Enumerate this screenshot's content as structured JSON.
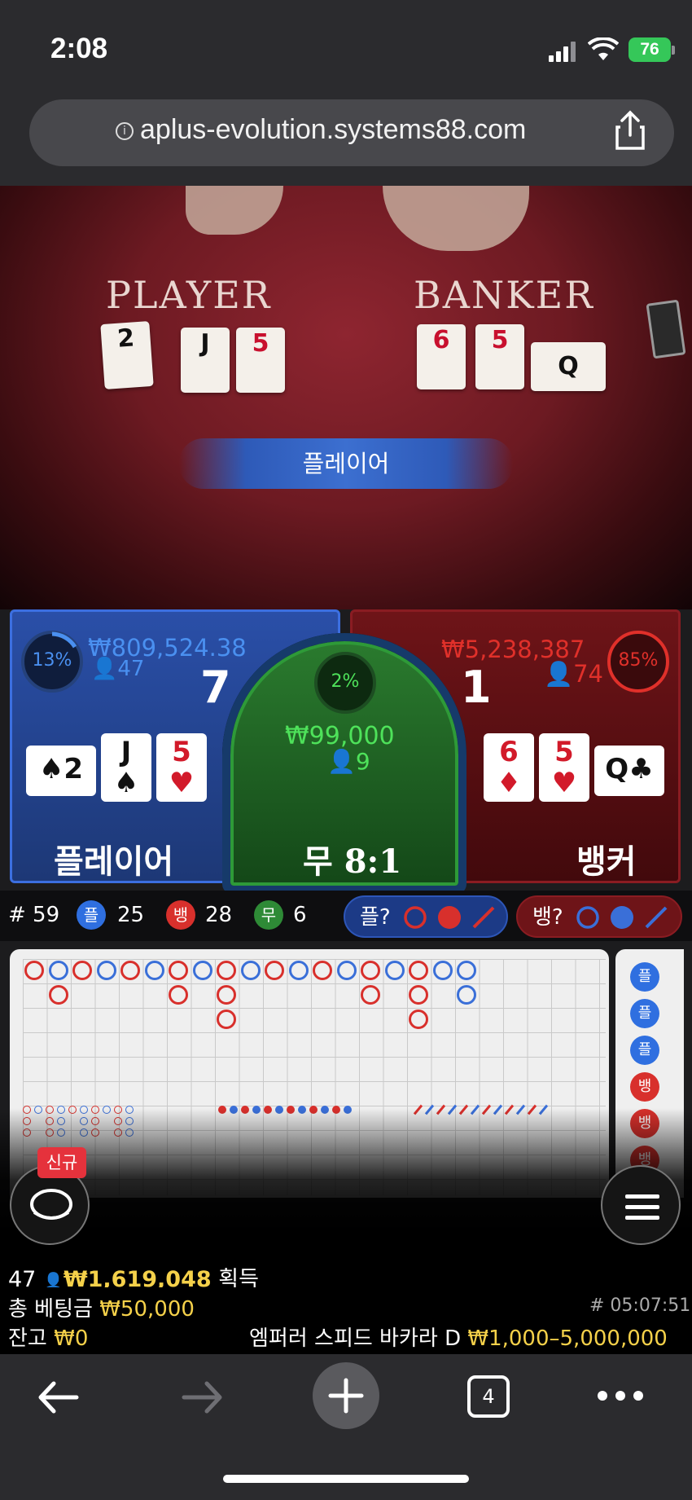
{
  "status_bar": {
    "time": "2:08",
    "battery": "76"
  },
  "browser": {
    "url": "aplus-evolution.systems88.com",
    "tab_count": "4"
  },
  "video": {
    "player_label": "PLAYER",
    "banker_label": "BANKER",
    "player_cards": [
      "2",
      "J",
      "5"
    ],
    "banker_cards": [
      "6",
      "5",
      "Q"
    ],
    "result": "플레이어"
  },
  "bets": {
    "player": {
      "percent": "13%",
      "amount": "₩809,524.38",
      "players": "47",
      "score": "7",
      "title": "플레이어",
      "cards": [
        {
          "rank": "2",
          "suit": "♠"
        },
        {
          "rank": "J",
          "suit": "♠"
        },
        {
          "rank": "5",
          "suit": "♥"
        }
      ]
    },
    "tie": {
      "percent": "2%",
      "amount": "₩99,000",
      "players": "9",
      "title": "무 8:1"
    },
    "banker": {
      "percent": "85%",
      "amount": "₩5,238,387",
      "players": "74",
      "score": "1",
      "title": "뱅커",
      "cards": [
        {
          "rank": "6",
          "suit": "♦"
        },
        {
          "rank": "5",
          "suit": "♥"
        },
        {
          "rank": "Q",
          "suit": "♣"
        }
      ]
    }
  },
  "stats": {
    "round": "# 59",
    "player_label": "플",
    "player_count": "25",
    "banker_label": "뱅",
    "banker_count": "28",
    "tie_label": "무",
    "tie_count": "6",
    "player_predict": "플?",
    "banker_predict": "뱅?"
  },
  "roadmap": {
    "top_row": [
      "r",
      "b",
      "r",
      "b",
      "r",
      "b",
      "r",
      "b",
      "r",
      "b",
      "r",
      "b",
      "r",
      "b",
      "r",
      "b",
      "r",
      "b",
      "b"
    ],
    "side": [
      "플",
      "플",
      "플",
      "뱅",
      "뱅",
      "뱅"
    ]
  },
  "chat": {
    "badge": "신규"
  },
  "win": {
    "players": "47",
    "amount": "₩1,619,048",
    "label": "획득"
  },
  "footer": {
    "total_bet_label": "총 베팅금",
    "total_bet": "₩50,000",
    "round_id": "# 05:07:51",
    "balance_label": "잔고",
    "balance": "₩0",
    "table_name": "엠퍼러 스피드 바카라 D",
    "limits": "₩1,000–5,000,000"
  }
}
